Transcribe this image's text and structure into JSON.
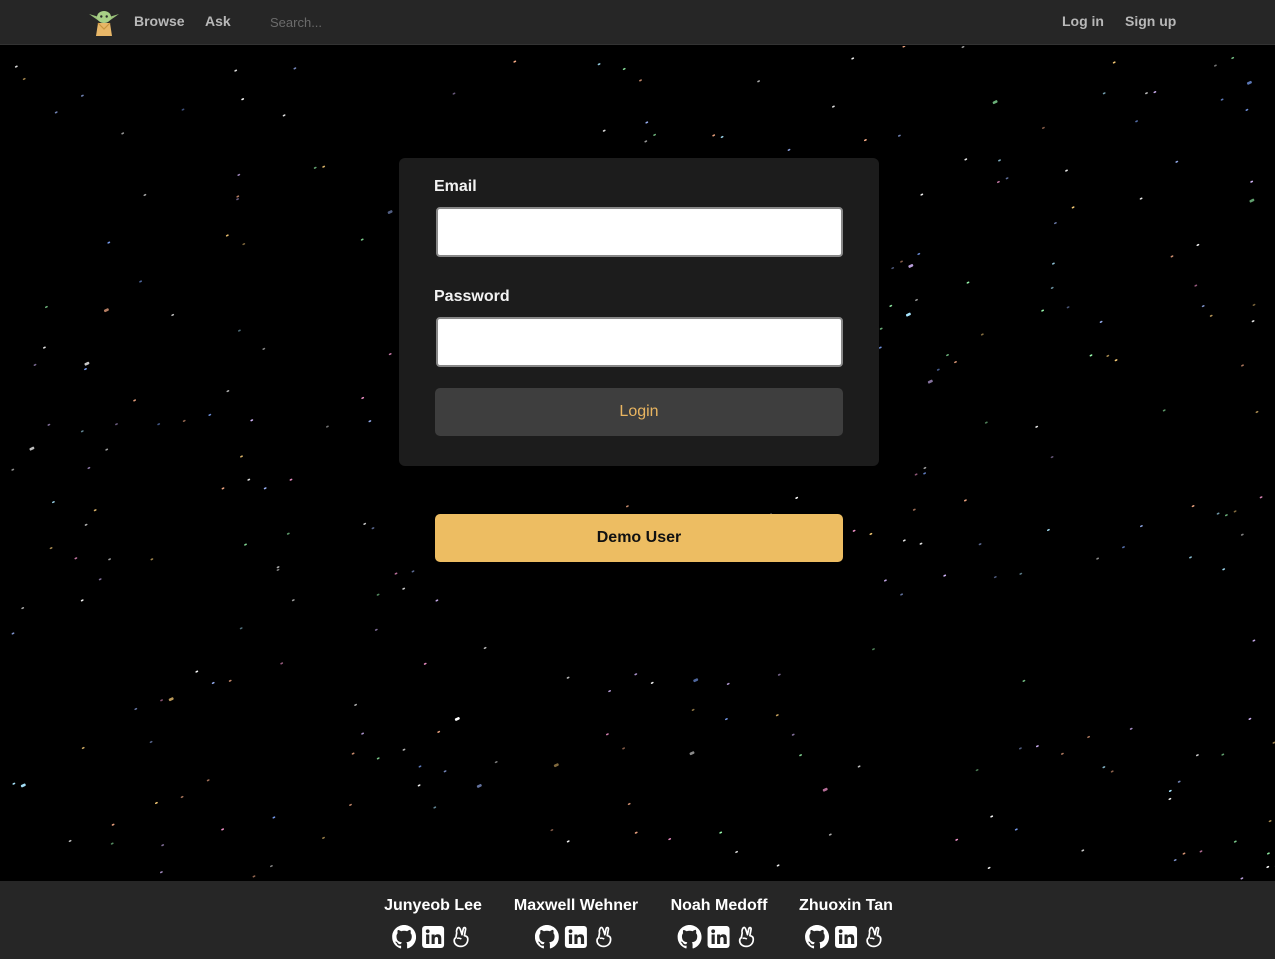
{
  "navbar": {
    "logo_icon": "baby-yoda-icon",
    "browse_label": "Browse",
    "ask_label": "Ask",
    "search_placeholder": "Search...",
    "login_label": "Log in",
    "signup_label": "Sign up"
  },
  "login_form": {
    "email_label": "Email",
    "email_value": "",
    "password_label": "Password",
    "password_value": "",
    "login_button": "Login"
  },
  "demo_button": "Demo User",
  "footer": {
    "developers": [
      {
        "name": "Junyeob Lee",
        "icons": [
          "github-icon",
          "linkedin-icon",
          "angellist-icon"
        ]
      },
      {
        "name": "Maxwell Wehner",
        "icons": [
          "github-icon",
          "linkedin-icon",
          "angellist-icon"
        ]
      },
      {
        "name": "Noah Medoff",
        "icons": [
          "github-icon",
          "linkedin-icon",
          "angellist-icon"
        ]
      },
      {
        "name": "Zhuoxin Tan",
        "icons": [
          "github-icon",
          "linkedin-icon",
          "angellist-icon"
        ]
      }
    ]
  },
  "colors": {
    "navbar_bg": "#262626",
    "card_bg": "#1c1c1c",
    "accent": "#edbd62",
    "login_text": "#e9b560"
  }
}
